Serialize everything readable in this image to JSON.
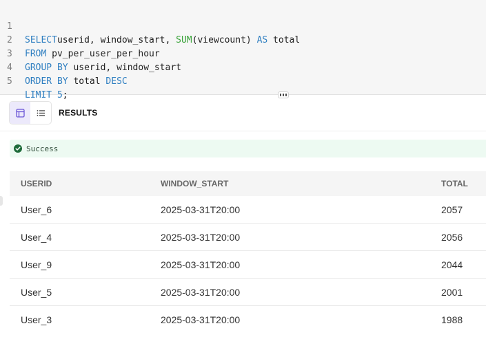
{
  "editor": {
    "lines": [
      {
        "num": "1",
        "tokens": [
          [
            "kw",
            "SELECT"
          ],
          [
            "",
            "userid, window_start, "
          ],
          [
            "fn",
            "SUM"
          ],
          [
            "",
            "(viewcount) "
          ],
          [
            "kw",
            "AS"
          ],
          [
            "",
            " total"
          ]
        ]
      },
      {
        "num": "2",
        "tokens": [
          [
            "kw",
            "FROM"
          ],
          [
            "",
            " pv_per_user_per_hour"
          ]
        ]
      },
      {
        "num": "3",
        "tokens": [
          [
            "kw",
            "GROUP BY"
          ],
          [
            "",
            " userid, window_start"
          ]
        ]
      },
      {
        "num": "4",
        "tokens": [
          [
            "kw",
            "ORDER BY"
          ],
          [
            "",
            " total "
          ],
          [
            "kw",
            "DESC"
          ]
        ]
      },
      {
        "num": "5",
        "tokens": [
          [
            "kw",
            "LIMIT"
          ],
          [
            "",
            " "
          ],
          [
            "num",
            "5"
          ],
          [
            "",
            ";"
          ]
        ]
      }
    ]
  },
  "toolbar": {
    "results_label": "RESULTS",
    "table_view_icon": "table-view-icon",
    "list_view_icon": "list-view-icon"
  },
  "status": {
    "text": "Success",
    "icon": "check-circle-icon",
    "color": "#1e6b3a"
  },
  "table": {
    "columns": [
      "USERID",
      "WINDOW_START",
      "TOTAL"
    ],
    "rows": [
      [
        "User_6",
        "2025-03-31T20:00",
        "2057"
      ],
      [
        "User_4",
        "2025-03-31T20:00",
        "2056"
      ],
      [
        "User_9",
        "2025-03-31T20:00",
        "2044"
      ],
      [
        "User_5",
        "2025-03-31T20:00",
        "2001"
      ],
      [
        "User_3",
        "2025-03-31T20:00",
        "1988"
      ]
    ]
  },
  "colors": {
    "keyword": "#2f7fc1",
    "function": "#3aa33a",
    "active_toggle": "#ece9fb",
    "success_bg": "#edfaf2"
  }
}
